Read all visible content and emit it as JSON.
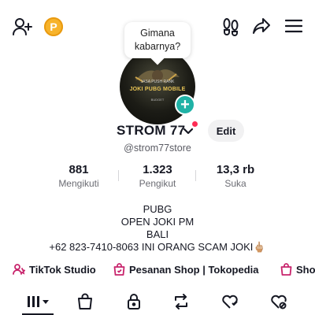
{
  "header": {
    "coin_label": "P",
    "greeting_bubble_line1": "Gimana",
    "greeting_bubble_line2": "kabarnya?"
  },
  "profile": {
    "avatar_text_top": "JASA PUSH RANK",
    "avatar_text_main": "JOKI PUBG MOBILE",
    "avatar_text_foot": "BUDGET",
    "add_icon": "+",
    "display_name": "STROM 77",
    "edit_button_label": "Edit",
    "username": "@strom77store"
  },
  "stats": [
    {
      "value": "881",
      "label": "Mengikuti"
    },
    {
      "value": "1.323",
      "label": "Pengikut"
    },
    {
      "value": "13,3 rb",
      "label": "Suka"
    }
  ],
  "bio": {
    "lines": [
      "PUBG",
      "OPEN JOKI PM",
      "BALI",
      "+62 823-7410-8063 INI ORANG SCAM JOKI🖕🏼"
    ]
  },
  "links": [
    {
      "label": "TikTok Studio",
      "icon": "creator-person-icon"
    },
    {
      "label": "Pesanan Shop | Tokopedia",
      "icon": "shop-bag-icon"
    },
    {
      "label": "Sho",
      "icon": "shop-bag-icon"
    }
  ],
  "tabs": [
    {
      "icon": "grid-videos-icon"
    },
    {
      "icon": "shop-bag-icon"
    },
    {
      "icon": "lock-icon"
    },
    {
      "icon": "repost-icon"
    },
    {
      "icon": "favorites-icon"
    },
    {
      "icon": "liked-hidden-icon"
    }
  ],
  "colors": {
    "accent_teal": "#20b2a6",
    "notification_red": "#fe2c55",
    "coin_gold": "#f7b32b",
    "link_icon_magenta": "#c8246c"
  }
}
